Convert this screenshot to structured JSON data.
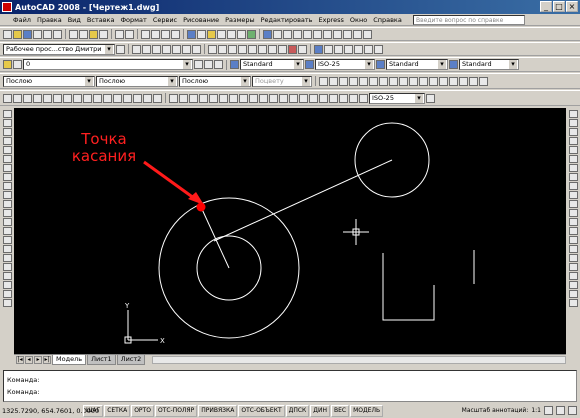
{
  "window": {
    "title": "AutoCAD 2008 - [Чертеж1.dwg]"
  },
  "menu": [
    "Файл",
    "Правка",
    "Вид",
    "Вставка",
    "Формат",
    "Сервис",
    "Рисование",
    "Размеры",
    "Редактировать",
    "Express",
    "Окно",
    "Справка"
  ],
  "search_placeholder": "Введите вопрос по справке",
  "workspace": "Рабочее прос...ство Дмитри",
  "layer": "0",
  "text_style": "Standard",
  "dim_style": "ISO-25",
  "table_style": "Standard",
  "multileader_style": "Standard",
  "color": "Послою",
  "linetype": "Послою",
  "lineweight": "Послою",
  "plotstyle": "Поцвету",
  "dim_style_2": "ISO-25",
  "annotation": {
    "line1": "Точка",
    "line2": "касания"
  },
  "ucs": {
    "x": "X",
    "y": "Y"
  },
  "tabs": [
    "Модель",
    "Лист1",
    "Лист2"
  ],
  "command_lines": [
    "Команда:",
    "Команда:"
  ],
  "status": {
    "coords": "1325.7290, 654.7601, 0.0000",
    "toggles": [
      "ШАГ",
      "СЕТКА",
      "ОРТО",
      "ОТС-ПОЛЯР",
      "ПРИВЯЗКА",
      "ОТС-ОБЪЕКТ",
      "ДПСК",
      "ДИН",
      "ВЕС",
      "МОДЕЛЬ"
    ],
    "annotation_scale_label": "Масштаб аннотаций:",
    "annotation_scale": "1:1"
  },
  "colors": {
    "canvas": "#000000",
    "tangent_point": "#ff0000",
    "annotation": "#ff2020",
    "geometry": "#ffffff"
  }
}
